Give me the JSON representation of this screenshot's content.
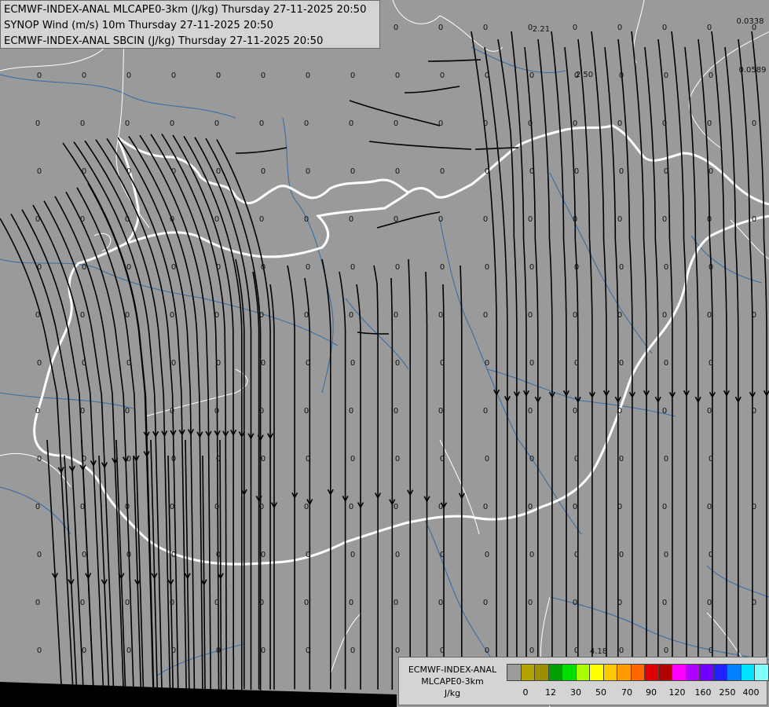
{
  "header_lines": [
    "ECMWF-INDEX-ANAL MLCAPE0-3km (J/kg) Thursday 27-11-2025 20:50",
    "SYNOP Wind (m/s) 10m Thursday 27-11-2025 20:50",
    "ECMWF-INDEX-ANAL SBCIN (J/kg) Thursday 27-11-2025 20:50"
  ],
  "legend": {
    "title_lines": [
      "ECMWF-INDEX-ANAL",
      "MLCAPE0-3km",
      "J/kg"
    ],
    "colors": [
      "#9b9b9b",
      "#b5a300",
      "#9c8f00",
      "#00a000",
      "#00dd00",
      "#a8ff00",
      "#ffff00",
      "#ffc800",
      "#ff9a00",
      "#ff6600",
      "#e00000",
      "#b00000",
      "#ff00ff",
      "#b000ff",
      "#7000ff",
      "#2020ff",
      "#0080ff",
      "#00e0ff",
      "#80ffff",
      "#ffffff"
    ],
    "tick_labels": [
      "0",
      "12",
      "30",
      "50",
      "70",
      "90",
      "120",
      "160",
      "250",
      "400"
    ]
  },
  "map": {
    "value_labels": [
      "2.21",
      "2.50",
      "0.0338",
      "0.0589",
      "4.18"
    ],
    "grid_value": "0"
  }
}
